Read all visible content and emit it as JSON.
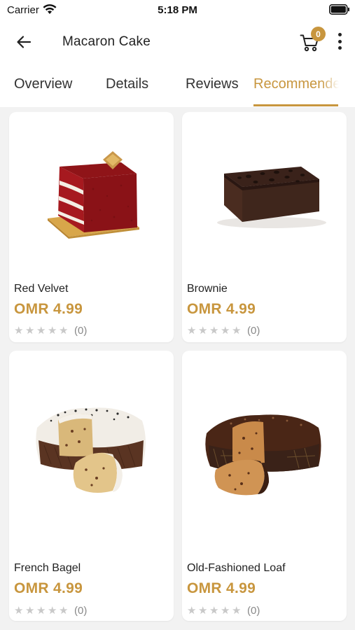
{
  "colors": {
    "accent": "#c8963e",
    "background": "#f2f2f2",
    "card": "#ffffff",
    "star_empty": "#c9c9c9"
  },
  "status_bar": {
    "carrier": "Carrier",
    "time": "5:18 PM",
    "icons": [
      "wifi-icon",
      "battery-icon"
    ]
  },
  "header": {
    "title": "Macaron Cake",
    "back_icon": "arrow-left-icon",
    "cart_icon": "shopping-cart-icon",
    "cart_count": "0",
    "more_icon": "more-vertical-icon"
  },
  "tabs": [
    {
      "label": "Overview",
      "active": false
    },
    {
      "label": "Details",
      "active": false
    },
    {
      "label": "Reviews",
      "active": false
    },
    {
      "label": "Recommended",
      "active": true
    }
  ],
  "products": [
    {
      "name": "Red Velvet",
      "price": "OMR 4.99",
      "rating": 0,
      "reviews": "(0)",
      "image": "red-velvet-cake-slice"
    },
    {
      "name": "Brownie",
      "price": "OMR 4.99",
      "rating": 0,
      "reviews": "(0)",
      "image": "chocolate-brownie"
    },
    {
      "name": "French Bagel",
      "price": "OMR 4.99",
      "rating": 0,
      "reviews": "(0)",
      "image": "white-chocolate-colomba-cake"
    },
    {
      "name": "Old-Fashioned Loaf",
      "price": "OMR 4.99",
      "rating": 0,
      "reviews": "(0)",
      "image": "chocolate-colomba-cake"
    }
  ]
}
